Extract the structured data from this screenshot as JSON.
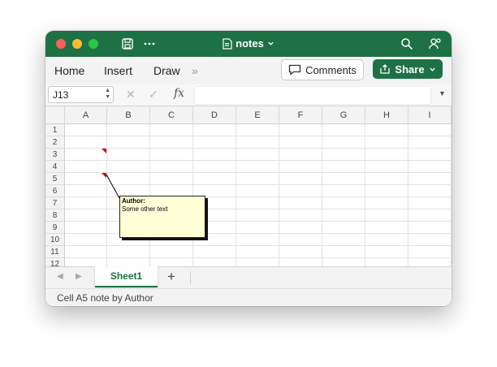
{
  "window": {
    "title": "notes",
    "icons": [
      "save-icon",
      "more-icon",
      "search-icon",
      "share-people-icon",
      "document-icon",
      "chevron-down-icon"
    ]
  },
  "ribbon": {
    "tabs": [
      "Home",
      "Insert",
      "Draw"
    ],
    "overflow": "»",
    "comments_label": "Comments",
    "share_label": "Share"
  },
  "formula_bar": {
    "name_box": "J13",
    "fx_label": "fx",
    "cancel_symbol": "✕",
    "confirm_symbol": "✓",
    "formula": ""
  },
  "grid": {
    "columns": [
      "A",
      "B",
      "C",
      "D",
      "E",
      "F",
      "G",
      "H",
      "I"
    ],
    "rows": [
      "1",
      "2",
      "3",
      "4",
      "5",
      "6",
      "7",
      "8",
      "9",
      "10",
      "11",
      "12"
    ],
    "note_indicator_cells": [
      "A3",
      "A5"
    ]
  },
  "note": {
    "author": "Author:",
    "text": "Some other text",
    "color": "#ffffd8"
  },
  "sheets": {
    "tabs": [
      "Sheet1"
    ],
    "add_label": "+",
    "prev": "◀",
    "next": "▶"
  },
  "status": {
    "text": "Cell A5 note by Author"
  },
  "colors": {
    "accent": "#1e7145",
    "note_indicator": "#d60000"
  }
}
